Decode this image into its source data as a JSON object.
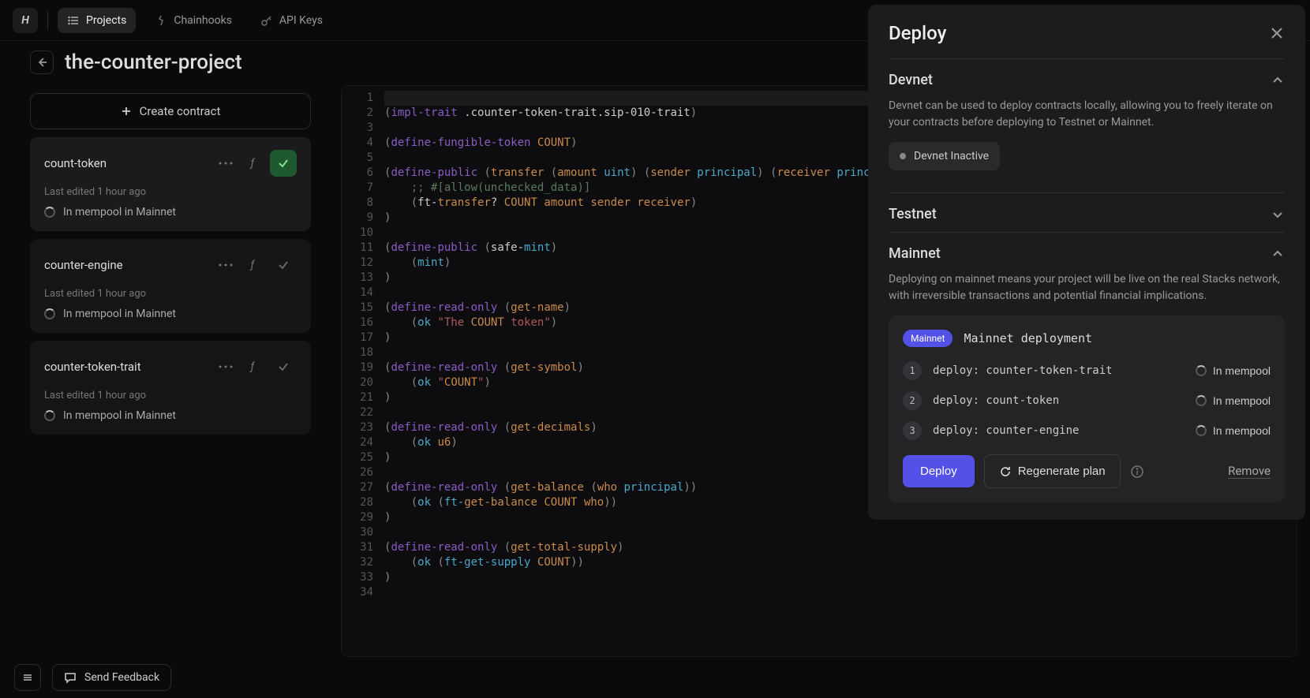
{
  "nav": {
    "projects": "Projects",
    "chainhooks": "Chainhooks",
    "apikeys": "API Keys"
  },
  "project": {
    "title": "the-counter-project",
    "create_contract": "Create contract"
  },
  "contracts": [
    {
      "name": "count-token",
      "edited": "Last edited 1 hour ago",
      "status": "In mempool in Mainnet",
      "ok": true
    },
    {
      "name": "counter-engine",
      "edited": "Last edited 1 hour ago",
      "status": "In mempool in Mainnet",
      "ok": false
    },
    {
      "name": "counter-token-trait",
      "edited": "Last edited 1 hour ago",
      "status": "In mempool in Mainnet",
      "ok": false
    }
  ],
  "footer": {
    "feedback": "Send Feedback"
  },
  "deploy": {
    "title": "Deploy",
    "devnet": {
      "title": "Devnet",
      "desc": "Devnet can be used to deploy contracts locally, allowing you to freely iterate on your contracts before deploying to Testnet or Mainnet.",
      "status": "Devnet Inactive"
    },
    "testnet": {
      "title": "Testnet"
    },
    "mainnet": {
      "title": "Mainnet",
      "desc": "Deploying on mainnet means your project will be live on the real Stacks network, with irreversible transactions and potential financial implications.",
      "badge": "Mainnet",
      "name": "Mainnet deployment",
      "steps": [
        {
          "num": "1",
          "label": "deploy: counter-token-trait",
          "status": "In mempool"
        },
        {
          "num": "2",
          "label": "deploy: count-token",
          "status": "In mempool"
        },
        {
          "num": "3",
          "label": "deploy: counter-engine",
          "status": "In mempool"
        }
      ],
      "deploy_btn": "Deploy",
      "regen_btn": "Regenerate plan",
      "remove": "Remove"
    }
  },
  "code": {
    "lines": [
      "",
      "(impl-trait .counter-token-trait.sip-010-trait)",
      "",
      "(define-fungible-token COUNT)",
      "",
      "(define-public (transfer (amount uint) (sender principal) (receiver principal",
      "    ;; #[allow(unchecked_data)]",
      "    (ft-transfer? COUNT amount sender receiver)",
      ")",
      "",
      "(define-public (safe-mint)",
      "    (mint)",
      ")",
      "",
      "(define-read-only (get-name)",
      "    (ok \"The COUNT token\")",
      ")",
      "",
      "(define-read-only (get-symbol)",
      "    (ok \"COUNT\")",
      ")",
      "",
      "(define-read-only (get-decimals)",
      "    (ok u6)",
      ")",
      "",
      "(define-read-only (get-balance (who principal))",
      "    (ok (ft-get-balance COUNT who))",
      ")",
      "",
      "(define-read-only (get-total-supply)",
      "    (ok (ft-get-supply COUNT))",
      ")",
      ""
    ]
  }
}
